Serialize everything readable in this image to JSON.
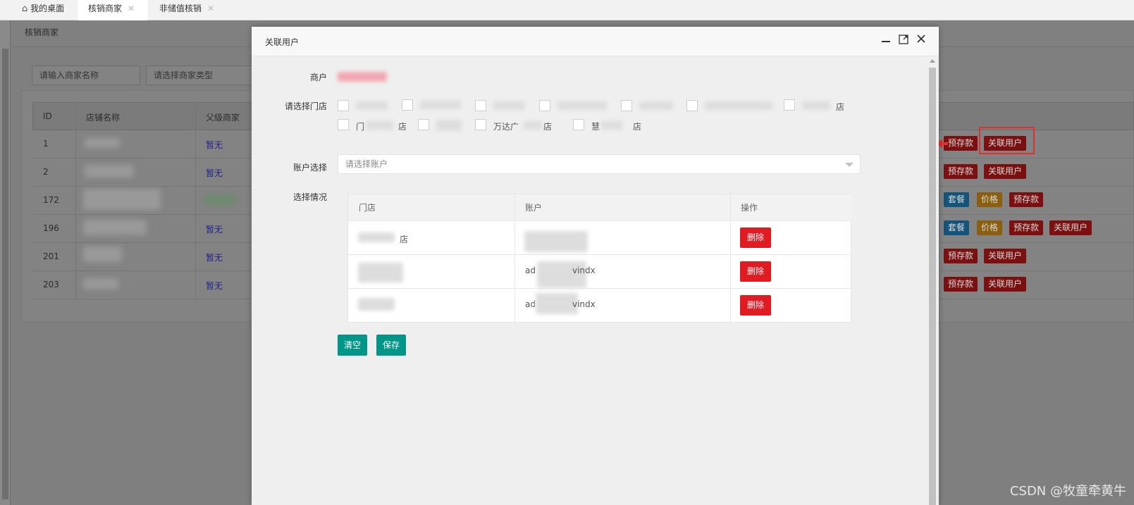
{
  "tabs": [
    {
      "label": "我的桌面",
      "icon": "home-icon"
    },
    {
      "label": "核销商家",
      "close": "✕"
    },
    {
      "label": "非储值核销",
      "close": "✕"
    }
  ],
  "breadcrumb": "核销商家",
  "search": {
    "name_placeholder": "请输入商家名称",
    "type_placeholder": "请选择商家类型"
  },
  "list": {
    "headers": [
      "ID",
      "店铺名称",
      "父级商家"
    ],
    "rows": [
      {
        "id": "1",
        "parent": "暂无",
        "actions": [
          "预存款",
          "关联用户"
        ]
      },
      {
        "id": "2",
        "parent": "暂无",
        "actions": [
          "预存款",
          "关联用户"
        ]
      },
      {
        "id": "172",
        "parent": "",
        "actions": [
          "套餐",
          "价格",
          "预存款"
        ]
      },
      {
        "id": "196",
        "parent": "暂无",
        "actions": [
          "套餐",
          "价格",
          "预存款",
          "关联用户"
        ]
      },
      {
        "id": "201",
        "parent": "暂无",
        "actions": [
          "预存款",
          "关联用户"
        ]
      },
      {
        "id": "203",
        "parent": "暂无",
        "actions": [
          "预存款",
          "关联用户"
        ]
      }
    ]
  },
  "modal": {
    "title": "关联用户",
    "merchant_label": "商户",
    "store_label": "请选择门店",
    "stores_row1": [
      "",
      "",
      "",
      "",
      "",
      "",
      "店"
    ],
    "stores_row2": [
      "门",
      "",
      "万达广",
      "慧"
    ],
    "store2_suffix": "店",
    "store3_suffix": "店",
    "account_label": "账户选择",
    "account_placeholder": "请选择账户",
    "selection_label": "选择情况",
    "table_headers": [
      "门店",
      "账户",
      "操作"
    ],
    "table_rows": [
      {
        "store": "店",
        "account": "",
        "action": "删除"
      },
      {
        "store": "",
        "account": "ad",
        "account_suffix": "vindx",
        "action": "删除"
      },
      {
        "store": "",
        "account": "ad",
        "account_suffix": "vindx",
        "action": "删除"
      }
    ],
    "clear_label": "清空",
    "save_label": "保存"
  },
  "watermark": "CSDN @牧童牵黄牛",
  "colors": {
    "accent_green": "#009688",
    "danger_red": "#e21b23",
    "highlight": "#e4302b"
  }
}
